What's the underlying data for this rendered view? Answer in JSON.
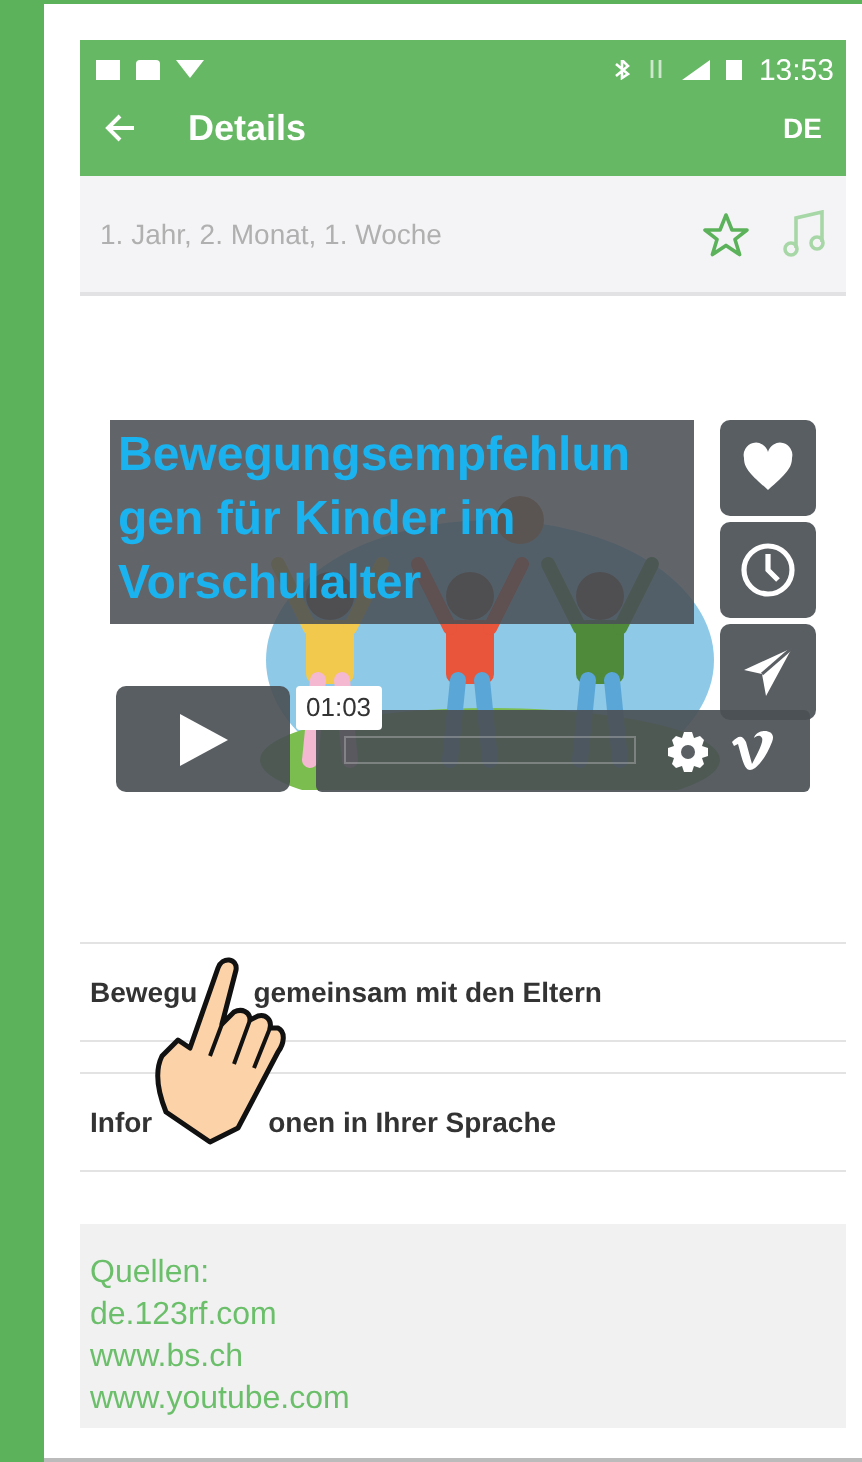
{
  "status_bar": {
    "time": "13:53"
  },
  "app_bar": {
    "title": "Details",
    "language": "DE"
  },
  "subheader": {
    "text": "1. Jahr, 2. Monat, 1. Woche"
  },
  "video": {
    "kind": "picture",
    "title_lines": [
      "Bewegungsempfehlun",
      "gen für Kinder im",
      "Vorschulalter"
    ],
    "timestamp": "01:03"
  },
  "links": [
    {
      "parts": [
        "Bewegu",
        "gemeinsam mit den Eltern"
      ]
    },
    {
      "parts": [
        "Infor",
        "onen in Ihrer Sprache"
      ]
    }
  ],
  "sources": {
    "heading": "Quellen:",
    "items": [
      "de.123rf.com",
      "www.bs.ch",
      "www.youtube.com"
    ]
  }
}
